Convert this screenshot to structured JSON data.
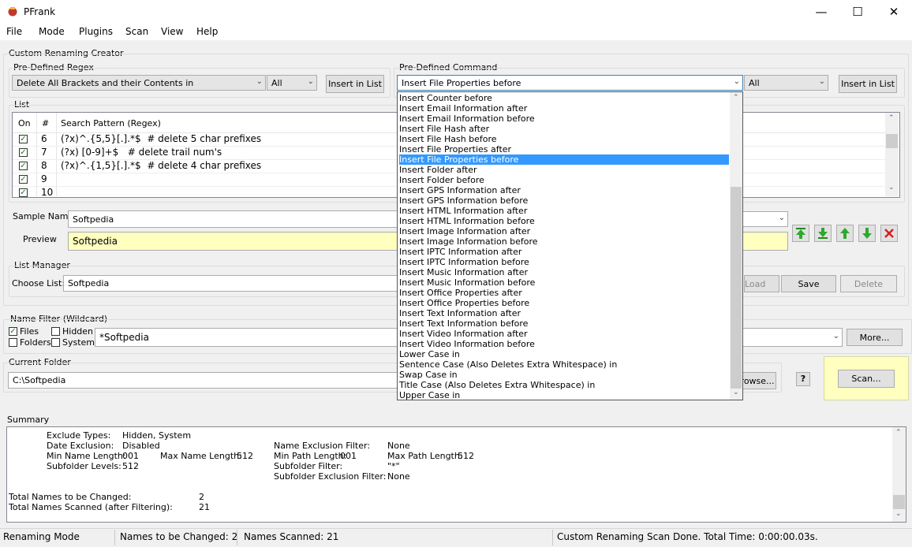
{
  "window": {
    "title": "PFrank"
  },
  "menu": [
    "File",
    "Mode",
    "Plugins",
    "Scan",
    "View",
    "Help"
  ],
  "crc": {
    "title": "Custom Renaming Creator",
    "regex_label": "Pre-Defined Regex",
    "regex_value": "Delete All Brackets and their Contents in",
    "regex_scope": "All",
    "insert_btn": "Insert in List",
    "command_label": "Pre-Defined Command",
    "command_value": "Insert File Properties before",
    "command_scope": "All",
    "insert_btn2": "Insert in List"
  },
  "list": {
    "title": "List",
    "headers": {
      "on": "On",
      "num": "#",
      "pattern": "Search Pattern (Regex)"
    },
    "rows": [
      {
        "num": "6",
        "pattern": "(?x)^.{5,5}[.].*$  # delete 5 char prefixes"
      },
      {
        "num": "7",
        "pattern": "(?x) [0-9]+$   # delete trail num's"
      },
      {
        "num": "8",
        "pattern": "(?x)^.{1,5}[.].*$  # delete 4 char prefixes"
      },
      {
        "num": "9",
        "pattern": ""
      },
      {
        "num": "10",
        "pattern": ""
      }
    ]
  },
  "sample": {
    "label": "Sample Name",
    "value": "Softpedia",
    "preview_label": "Preview",
    "preview_value": "Softpedia"
  },
  "list_manager": {
    "title": "List Manager",
    "choose_label": "Choose List:",
    "choose_value": "Softpedia",
    "load_btn": "Load",
    "save_btn": "Save",
    "delete_btn": "Delete"
  },
  "name_filter": {
    "title": "Name Filter (Wildcard)",
    "files": "Files",
    "folders": "Folders",
    "hidden": "Hidden",
    "system": "System",
    "value": "*Softpedia",
    "more_btn": "More..."
  },
  "current_folder": {
    "title": "Current Folder",
    "value": "C:\\Softpedia",
    "browse_btn": "Browse...",
    "help_btn": "?",
    "scan_btn": "Scan..."
  },
  "dropdown_items": [
    "Insert Counter before",
    "Insert Email Information after",
    "Insert Email Information before",
    "Insert File Hash after",
    "Insert File Hash before",
    "Insert File Properties after",
    "Insert File Properties before",
    "Insert Folder after",
    "Insert Folder before",
    "Insert GPS Information after",
    "Insert GPS Information before",
    "Insert HTML Information after",
    "Insert HTML Information before",
    "Insert Image Information after",
    "Insert Image Information before",
    "Insert IPTC Information after",
    "Insert IPTC Information before",
    "Insert Music Information after",
    "Insert Music Information before",
    "Insert Office Properties after",
    "Insert Office Properties before",
    "Insert Text Information after",
    "Insert Text Information before",
    "Insert Video Information after",
    "Insert Video Information before",
    "Lower Case in",
    "Sentence Case (Also Deletes Extra Whitespace) in",
    "Swap Case in",
    "Title Case (Also Deletes Extra Whitespace) in",
    "Upper Case in"
  ],
  "summary": {
    "title": "Summary",
    "exclude_types_label": "Exclude Types:",
    "exclude_types": "Hidden, System",
    "date_exclusion_label": "Date Exclusion:",
    "date_exclusion": "Disabled",
    "min_name_label": "Min Name Length:",
    "min_name": "001",
    "max_name_label": "Max Name Length:",
    "max_name": "512",
    "subfolder_levels_label": "Subfolder Levels:",
    "subfolder_levels": "512",
    "name_excl_label": "Name Exclusion Filter:",
    "name_excl": "None",
    "min_path_label": "Min Path Length:",
    "min_path": "001",
    "max_path_label": "Max Path Length:",
    "max_path": "512",
    "subfolder_filter_label": "Subfolder Filter:",
    "subfolder_filter": "\"*\"",
    "subfolder_excl_label": "Subfolder Exclusion Filter:",
    "subfolder_excl": "None",
    "total_changed_label": "Total Names to be Changed:",
    "total_changed": "2",
    "total_scanned_label": "Total Names Scanned (after Filtering):",
    "total_scanned": "21"
  },
  "status": {
    "mode": "Renaming Mode",
    "changed": "Names to be Changed: 2",
    "scanned": "Names Scanned: 21",
    "done": "Custom Renaming Scan Done.  Total Time: 0:00:00.03s."
  }
}
